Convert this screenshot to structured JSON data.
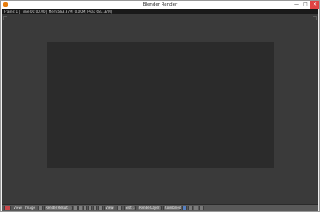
{
  "window": {
    "title": "Blender Render",
    "minimize_glyph": "—",
    "maximize_glyph": "□",
    "close_glyph": "✕"
  },
  "info": {
    "text": "Frame:1 | Time:00:00.00 | Mem:683.37M (0.00M, Peak 683.37M)"
  },
  "footer": {
    "view": "View",
    "image": "Image",
    "image_name": "Render Result",
    "view_menu": "View",
    "slot": "Slot 1",
    "render_layer": "RenderLayer",
    "pass": "Combined"
  },
  "colors": {
    "viewport_bg": "#3a3a3a",
    "render_area": "#2b2b2b",
    "header": "#191919",
    "footer": "#595959",
    "accent": "#5680c2"
  }
}
